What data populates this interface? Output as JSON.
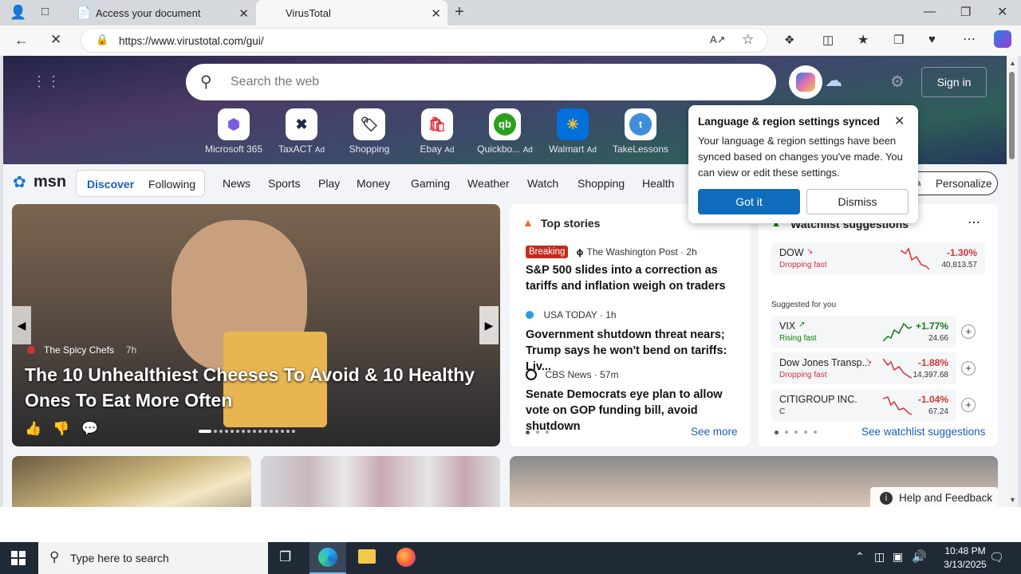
{
  "browser": {
    "tabs": [
      {
        "label": "Access your document"
      },
      {
        "label": "VirusTotal"
      }
    ],
    "url": "https://www.virustotal.com/gui/"
  },
  "msn": {
    "search_placeholder": "Search the web",
    "sign_in": "Sign in",
    "tiles": [
      {
        "label": "Microsoft 365",
        "ad": ""
      },
      {
        "label": "TaxACT",
        "ad": "Ad"
      },
      {
        "label": "Shopping",
        "ad": ""
      },
      {
        "label": "Ebay",
        "ad": "Ad"
      },
      {
        "label": "Quickbo...",
        "ad": "Ad"
      },
      {
        "label": "Walmart",
        "ad": "Ad"
      },
      {
        "label": "TakeLessons",
        "ad": ""
      }
    ],
    "logo": "msn",
    "nav": {
      "discover": "Discover",
      "following": "Following",
      "items": [
        "News",
        "Sports",
        "Play",
        "Money",
        "Gaming",
        "Weather",
        "Watch",
        "Shopping",
        "Health"
      ],
      "personalize": "Personalize"
    },
    "hero": {
      "source": "The Spicy Chefs",
      "age": "7h",
      "title": "The 10 Unhealthiest Cheeses To Avoid & 10 Healthy Ones To Eat More Often"
    },
    "top_stories": {
      "header": "Top stories",
      "breaking": "Breaking",
      "items": [
        {
          "source": "The Washington Post · 2h",
          "title": "S&P 500 slides into a correction as tariffs and inflation weigh on traders"
        },
        {
          "source": "USA TODAY · 1h",
          "title": "Government shutdown threat nears; Trump says he won't bend on tariffs: Liv..."
        },
        {
          "source": "CBS News · 57m",
          "title": "Senate Democrats eye plan to allow vote on GOP funding bill, avoid shutdown"
        }
      ],
      "see_more": "See more"
    },
    "watchlist": {
      "header": "Watchlist suggestions",
      "suggested_label": "Suggested for you",
      "stocks": [
        {
          "name": "DOW",
          "status": "Dropping fast",
          "change": "-1.30%",
          "price": "40,813.57",
          "color": "#d13438"
        },
        {
          "name": "VIX",
          "status": "Rising fast",
          "change": "+1.77%",
          "price": "24.66",
          "color": "#107c10"
        },
        {
          "name": "Dow Jones Transp...",
          "status": "Dropping fast",
          "change": "-1.88%",
          "price": "14,397.68",
          "color": "#d13438"
        },
        {
          "name": "CITIGROUP INC.",
          "status": "C",
          "change": "-1.04%",
          "price": "67.24",
          "color": "#d13438"
        }
      ],
      "see_suggestions": "See watchlist suggestions"
    },
    "popup": {
      "title": "Language & region settings synced",
      "body": "Your language & region settings have been synced based on changes you've made. You can view or edit these settings.",
      "got_it": "Got it",
      "dismiss": "Dismiss"
    },
    "help": "Help and Feedback"
  },
  "taskbar": {
    "search_placeholder": "Type here to search",
    "time": "10:48 PM",
    "date": "3/13/2025"
  }
}
